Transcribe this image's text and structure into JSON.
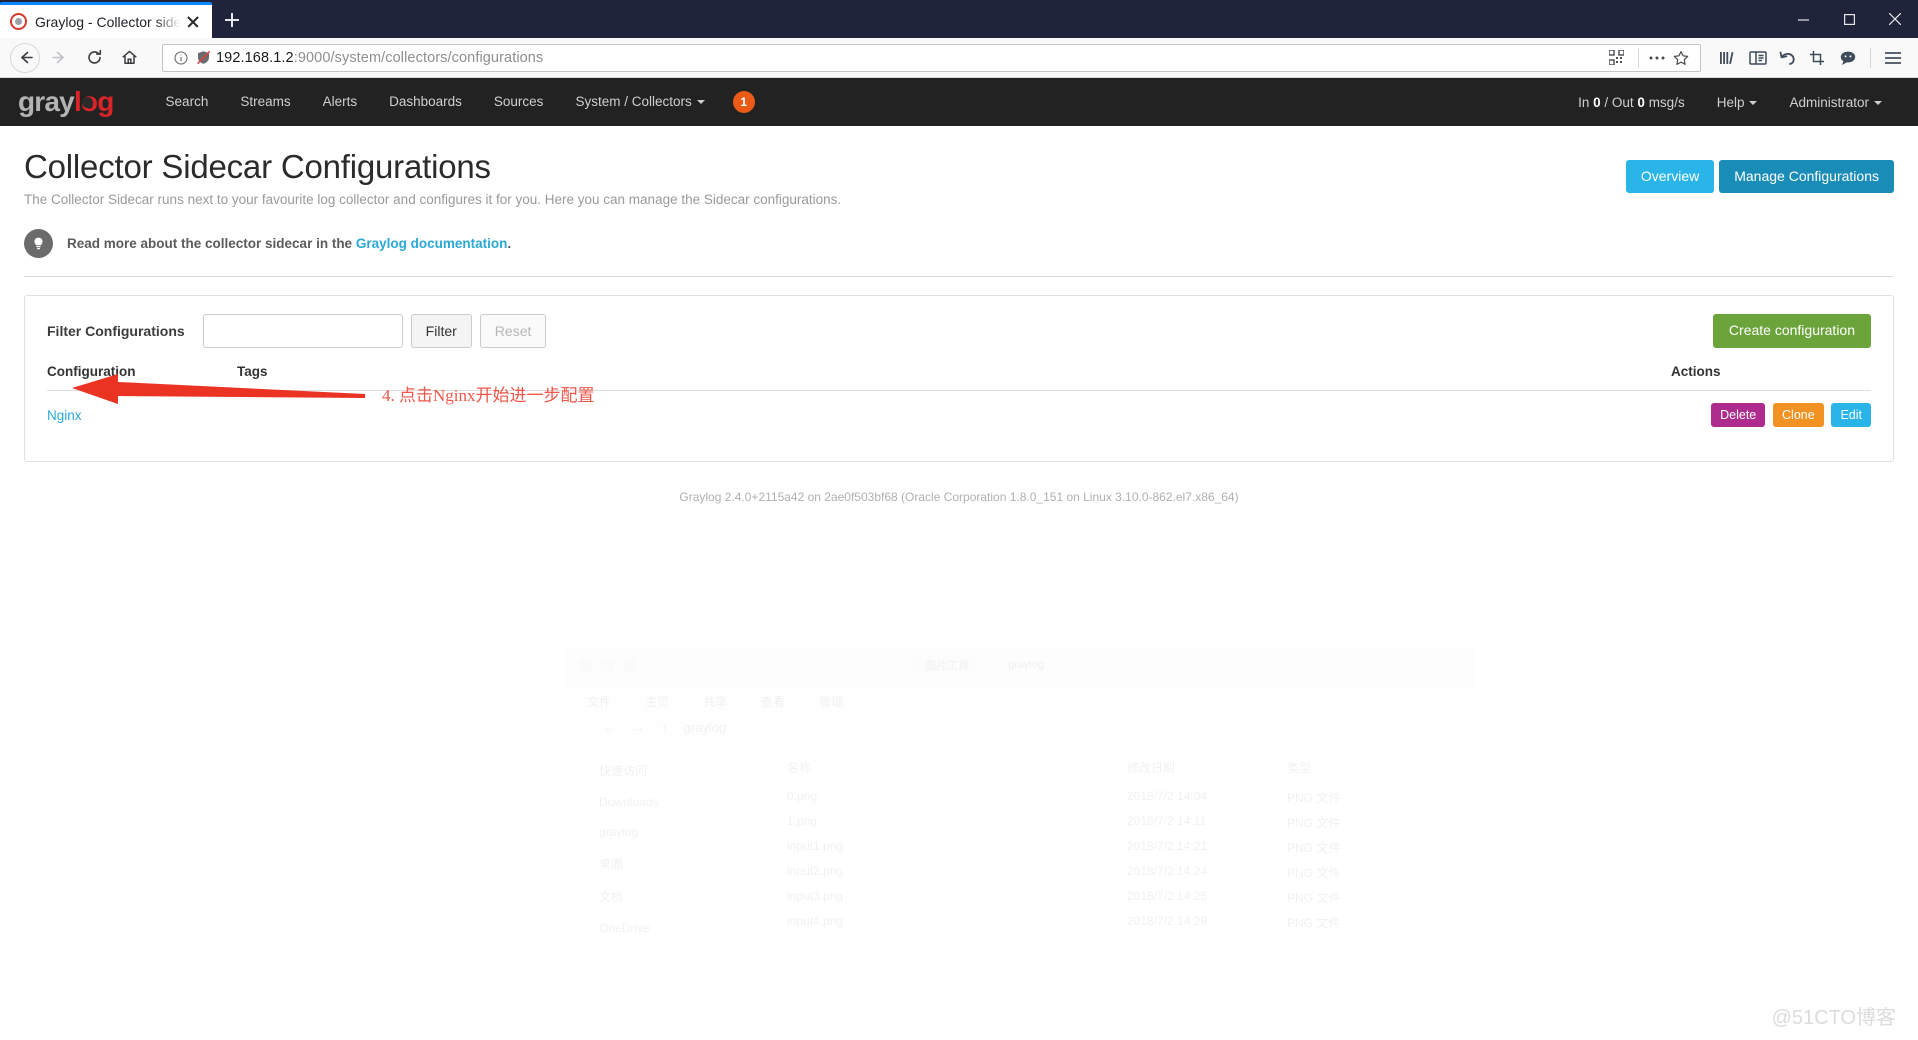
{
  "browser": {
    "tab": {
      "title": "Graylog - Collector sidecar c",
      "favicon": "graylog-favicon-icon",
      "close": "close-icon"
    },
    "newtab_label": "+",
    "nav": {
      "back": "back-arrow-icon",
      "forward": "forward-arrow-icon",
      "reload": "reload-icon",
      "home": "home-icon"
    },
    "url": {
      "host": "192.168.1.2",
      "rest": ":9000/system/collectors/configurations",
      "full": "192.168.1.2:9000/system/collectors/configurations",
      "info_icon": "info-circle-icon",
      "shield_icon": "shield-off-icon",
      "qr_icon": "qr-code-icon",
      "more_icon": "page-actions-ellipsis-icon",
      "bookmark_icon": "star-icon"
    },
    "toolbar_right": [
      {
        "name": "library-icon"
      },
      {
        "name": "sidebar-icon"
      },
      {
        "name": "undo-icon"
      },
      {
        "name": "screenshot-crop-icon"
      },
      {
        "name": "pocket-chat-icon"
      },
      {
        "name": "hamburger-menu-icon"
      }
    ],
    "window_controls": {
      "minimize": "minimize-icon",
      "maximize": "maximize-icon",
      "close": "close-window-icon"
    }
  },
  "graylog_nav": {
    "logo": {
      "part1": "gray",
      "part2": "log"
    },
    "items": [
      {
        "label": "Search"
      },
      {
        "label": "Streams"
      },
      {
        "label": "Alerts"
      },
      {
        "label": "Dashboards"
      },
      {
        "label": "Sources"
      },
      {
        "label": "System / Collectors",
        "has_caret": true
      }
    ],
    "badge": "1",
    "throughput": {
      "prefix": "In ",
      "in": "0",
      "mid": " / Out ",
      "out": "0",
      "suffix": " msg/s",
      "full": "In 0 / Out 0 msg/s"
    },
    "help": "Help",
    "user": "Administrator"
  },
  "page": {
    "title": "Collector Sidecar Configurations",
    "description": "The Collector Sidecar runs next to your favourite log collector and configures it for you. Here you can manage the Sidecar configurations.",
    "buttons": {
      "overview": "Overview",
      "manage": "Manage Configurations"
    },
    "tip": {
      "icon": "lightbulb-icon",
      "prefix": "Read more about the collector sidecar in the ",
      "link": "Graylog documentation",
      "suffix": "."
    }
  },
  "filter": {
    "label": "Filter Configurations",
    "input_value": "",
    "placeholder": "",
    "filter_button": "Filter",
    "reset_button": "Reset",
    "create_button": "Create configuration"
  },
  "table": {
    "headers": {
      "configuration": "Configuration",
      "tags": "Tags",
      "actions": "Actions"
    },
    "rows": [
      {
        "configuration": "Nginx",
        "tags": "",
        "actions": [
          {
            "label": "Delete",
            "color": "#ad2c8e"
          },
          {
            "label": "Clone",
            "color": "#f29222"
          },
          {
            "label": "Edit",
            "color": "#29b5e8"
          }
        ]
      }
    ]
  },
  "annotation": {
    "text": "4. 点击Nginx开始进一步配置",
    "color": "#f0564a",
    "arrow": "red-arrow-pointing-left"
  },
  "footer": {
    "text": "Graylog 2.4.0+2115a42 on 2ae0f503bf68 (Oracle Corporation 1.8.0_151 on Linux 3.10.0-862.el7.x86_64)"
  },
  "watermark": "@51CTO博客",
  "ghost": {
    "window_title": "graylog",
    "ribbon": [
      "文件",
      "主页",
      "共享",
      "查看",
      "管理"
    ],
    "breadcrumb": "graylog",
    "sidebar": [
      "快速访问",
      "Downloads",
      "graylog",
      "桌面",
      "文档",
      "OneDrive"
    ],
    "columns": [
      "名称",
      "修改日期",
      "类型"
    ],
    "files": [
      {
        "name": "0.png",
        "date": "2018/7/2 14:04",
        "type": "PNG 文件"
      },
      {
        "name": "1.png",
        "date": "2018/7/2 14:11",
        "type": "PNG 文件"
      },
      {
        "name": "input1.png",
        "date": "2018/7/2 14:21",
        "type": "PNG 文件"
      },
      {
        "name": "input2.png",
        "date": "2018/7/2 14:24",
        "type": "PNG 文件"
      },
      {
        "name": "input3.png",
        "date": "2018/7/2 14:25",
        "type": "PNG 文件"
      },
      {
        "name": "input4.png",
        "date": "2018/7/2 14:29",
        "type": "PNG 文件"
      }
    ]
  }
}
